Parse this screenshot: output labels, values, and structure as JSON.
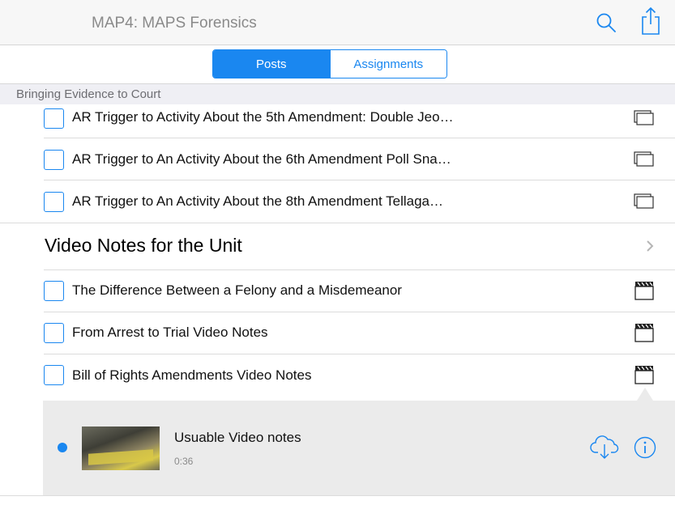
{
  "header": {
    "title": "MAP4: MAPS Forensics",
    "search_icon": "search-icon",
    "share_icon": "share-icon"
  },
  "segments": [
    {
      "label": "Posts",
      "selected": true
    },
    {
      "label": "Assignments",
      "selected": false
    }
  ],
  "section": {
    "title": "Bringing Evidence to Court"
  },
  "ar_items": [
    {
      "label": "AR Trigger to Activity About the 5th Amendment: Double Jeo…",
      "icon": "stacked-pages-icon"
    },
    {
      "label": "AR Trigger to An Activity About the 6th Amendment Poll Sna…",
      "icon": "stacked-pages-icon"
    },
    {
      "label": "AR Trigger to An Activity About the 8th Amendment Tellaga…",
      "icon": "stacked-pages-icon"
    }
  ],
  "unit": {
    "title": "Video Notes for the Unit"
  },
  "video_items": [
    {
      "label": "The Difference Between a Felony and a Misdemeanor",
      "icon": "clapperboard-icon"
    },
    {
      "label": "From Arrest to Trial Video Notes",
      "icon": "clapperboard-icon"
    },
    {
      "label": "Bill of Rights Amendments Video Notes",
      "icon": "clapperboard-icon"
    }
  ],
  "detail": {
    "title": "Usuable Video notes",
    "duration": "0:36",
    "download_icon": "cloud-download-icon",
    "info_icon": "info-icon"
  },
  "colors": {
    "accent": "#1a87f0",
    "header_bg": "#f7f7f7",
    "section_bg": "#efeff4",
    "detail_bg": "#ebebeb"
  }
}
